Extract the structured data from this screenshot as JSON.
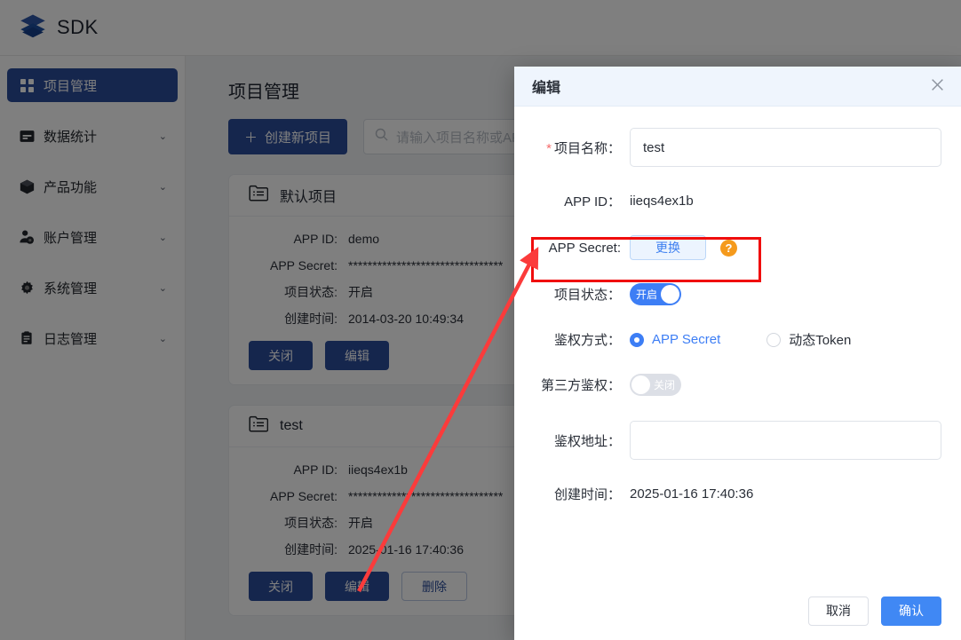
{
  "app": {
    "brand": "SDK",
    "brand_icon": "layers-icon",
    "accent": "#2b4c9b",
    "modal_accent": "#4088f4"
  },
  "sidebar": {
    "items": [
      {
        "label": "项目管理",
        "icon": "grid-icon",
        "active": true,
        "has_chevron": false
      },
      {
        "label": "数据统计",
        "icon": "chart-icon",
        "active": false,
        "has_chevron": true
      },
      {
        "label": "产品功能",
        "icon": "box-icon",
        "active": false,
        "has_chevron": true
      },
      {
        "label": "账户管理",
        "icon": "user-gear-icon",
        "active": false,
        "has_chevron": true
      },
      {
        "label": "系统管理",
        "icon": "gear-icon",
        "active": false,
        "has_chevron": true
      },
      {
        "label": "日志管理",
        "icon": "clipboard-icon",
        "active": false,
        "has_chevron": true
      }
    ],
    "chevron_glyph": "⌄"
  },
  "main": {
    "page_title": "项目管理",
    "create_button": "创建新项目",
    "create_button_icon": "plus-icon",
    "search": {
      "placeholder": "请输入项目名称或APP ID",
      "value": "",
      "icon": "search-icon"
    },
    "field_labels": {
      "app_id": "APP ID:",
      "app_secret": "APP Secret:",
      "status": "项目状态:",
      "created": "创建时间:"
    },
    "cards": [
      {
        "name": "默认项目",
        "icon": "folder-list-icon",
        "app_id": "demo",
        "app_secret": "********************************",
        "status": "开启",
        "created": "2014-03-20 10:49:34",
        "actions": [
          {
            "label": "关闭",
            "style": "primary"
          },
          {
            "label": "编辑",
            "style": "primary"
          }
        ]
      },
      {
        "name": "test",
        "icon": "folder-list-icon",
        "app_id": "iieqs4ex1b",
        "app_secret": "********************************",
        "status": "开启",
        "created": "2025-01-16 17:40:36",
        "actions": [
          {
            "label": "关闭",
            "style": "primary"
          },
          {
            "label": "编辑",
            "style": "primary"
          },
          {
            "label": "删除",
            "style": "ghost"
          }
        ]
      }
    ]
  },
  "modal": {
    "title": "编辑",
    "close_icon": "close-icon",
    "project_name": {
      "label": "项目名称：",
      "required": true,
      "value": "test",
      "placeholder": ""
    },
    "app_id": {
      "label": "APP ID：",
      "value": "iieqs4ex1b"
    },
    "app_secret": {
      "label": "APP Secret:",
      "change_button": "更换",
      "help_icon": "question-circle-icon",
      "help_glyph": "?"
    },
    "project_status": {
      "label": "项目状态：",
      "state": "on",
      "on_text": "开启",
      "off_text": "关闭"
    },
    "auth_method": {
      "label": "鉴权方式：",
      "options": [
        {
          "label": "APP Secret",
          "selected": true
        },
        {
          "label": "动态Token",
          "selected": false
        }
      ]
    },
    "third_party_auth": {
      "label": "第三方鉴权：",
      "state": "off",
      "on_text": "开启",
      "off_text": "关闭"
    },
    "auth_url": {
      "label": "鉴权地址：",
      "value": "",
      "placeholder": ""
    },
    "created": {
      "label": "创建时间：",
      "value": "2025-01-16 17:40:36"
    },
    "footer": {
      "cancel": "取消",
      "confirm": "确认"
    }
  },
  "annotations": {
    "highlight_color": "#f00d0d",
    "arrow_color": "#fb3b3b",
    "highlight_target": "APP Secret:",
    "arrow_from": "编辑",
    "arrow_to": "APP Secret:"
  }
}
